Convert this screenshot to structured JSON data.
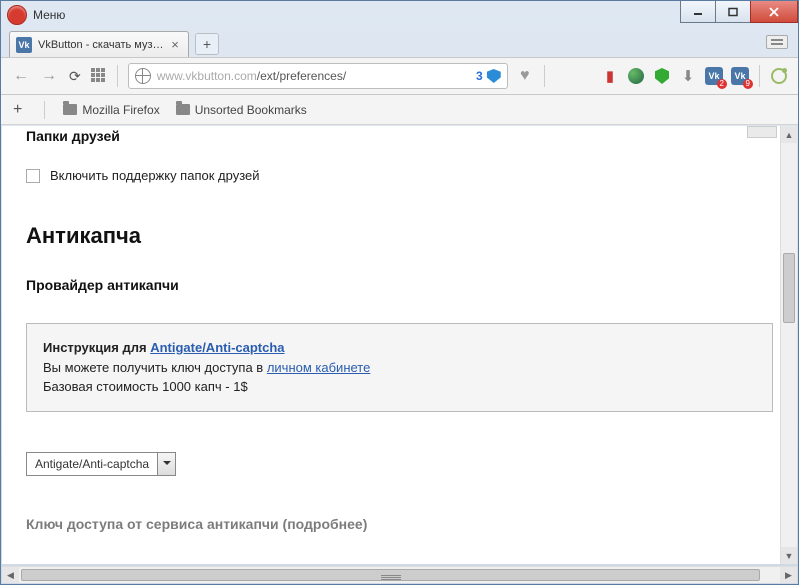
{
  "window": {
    "menu_label": "Меню"
  },
  "tabs": {
    "active": {
      "title": "VkButton - скачать музык",
      "favicon_text": "Vk"
    }
  },
  "addressbar": {
    "host": "www.vkbutton.com",
    "path": "/ext/preferences/",
    "indicator_count": "3"
  },
  "extensions": {
    "vk2_badge": "2",
    "vk9_badge": "9"
  },
  "bookmarks": {
    "item1": "Mozilla Firefox",
    "item2": "Unsorted Bookmarks"
  },
  "page": {
    "section_friends_heading": "Папки друзей",
    "friends_checkbox_label": "Включить поддержку папок друзей",
    "section_anticaptcha": "Антикапча",
    "provider_heading": "Провайдер антикапчи",
    "info_prefix": "Инструкция для ",
    "info_link1": "Antigate/Anti-captcha",
    "info_line2a": "Вы можете получить ключ доступа в ",
    "info_link2": "личном кабинете",
    "info_line3": "Базовая стоимость 1000 капч - 1$",
    "dropdown_value": "Antigate/Anti-captcha",
    "cutoff_text": "Ключ доступа от сервиса антикапчи (подробнее)"
  }
}
